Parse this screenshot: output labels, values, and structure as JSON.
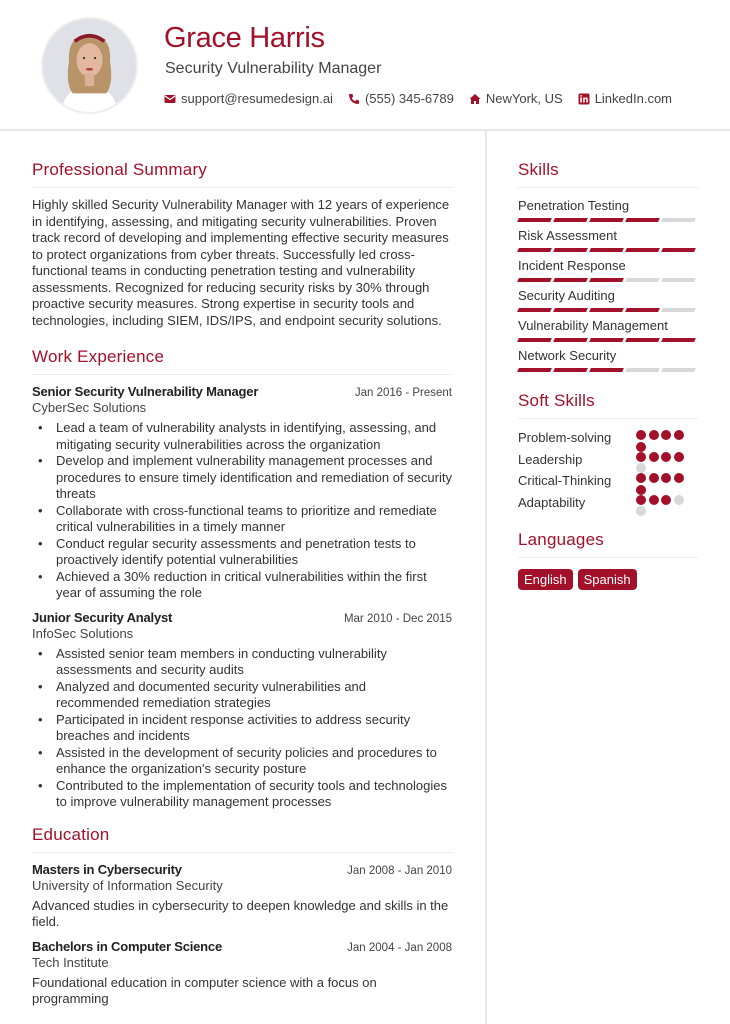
{
  "header": {
    "name": "Grace Harris",
    "title": "Security Vulnerability Manager",
    "contacts": [
      {
        "icon": "envelope-icon",
        "text": "support@resumedesign.ai"
      },
      {
        "icon": "phone-icon",
        "text": "(555) 345-6789"
      },
      {
        "icon": "home-icon",
        "text": "NewYork, US"
      },
      {
        "icon": "linkedin-icon",
        "text": "LinkedIn.com"
      }
    ]
  },
  "colors": {
    "accent": "#a31029",
    "inactive": "#d8d8d8"
  },
  "summary": {
    "title": "Professional Summary",
    "text": "Highly skilled Security Vulnerability Manager with 12 years of experience in identifying, assessing, and mitigating security vulnerabilities. Proven track record of developing and implementing effective security measures to protect organizations from cyber threats. Successfully led cross-functional teams in conducting penetration testing and vulnerability assessments. Recognized for reducing security risks by 30% through proactive security measures. Strong expertise in security tools and technologies, including SIEM, IDS/IPS, and endpoint security solutions."
  },
  "experience": {
    "title": "Work Experience",
    "jobs": [
      {
        "role": "Senior Security Vulnerability Manager",
        "dates": "Jan 2016 - Present",
        "company": "CyberSec Solutions",
        "bullets": [
          "Lead a team of vulnerability analysts in identifying, assessing, and mitigating security vulnerabilities across the organization",
          "Develop and implement vulnerability management processes and procedures to ensure timely identification and remediation of security threats",
          "Collaborate with cross-functional teams to prioritize and remediate critical vulnerabilities in a timely manner",
          "Conduct regular security assessments and penetration tests to proactively identify potential vulnerabilities",
          "Achieved a 30% reduction in critical vulnerabilities within the first year of assuming the role"
        ]
      },
      {
        "role": "Junior Security Analyst",
        "dates": "Mar 2010 - Dec 2015",
        "company": "InfoSec Solutions",
        "bullets": [
          "Assisted senior team members in conducting vulnerability assessments and security audits",
          "Analyzed and documented security vulnerabilities and recommended remediation strategies",
          "Participated in incident response activities to address security breaches and incidents",
          "Assisted in the development of security policies and procedures to enhance the organization's security posture",
          "Contributed to the implementation of security tools and technologies to improve vulnerability management processes"
        ]
      }
    ]
  },
  "education": {
    "title": "Education",
    "items": [
      {
        "degree": "Masters in Cybersecurity",
        "dates": "Jan 2008 - Jan 2010",
        "school": "University of Information Security",
        "description": "Advanced studies in cybersecurity to deepen knowledge and skills in the field."
      },
      {
        "degree": "Bachelors in Computer Science",
        "dates": "Jan 2004 - Jan 2008",
        "school": "Tech Institute",
        "description": "Foundational education in computer science with a focus on programming"
      }
    ]
  },
  "skills": {
    "title": "Skills",
    "max": 5,
    "items": [
      {
        "name": "Penetration Testing",
        "level": 4
      },
      {
        "name": "Risk Assessment",
        "level": 5
      },
      {
        "name": "Incident Response",
        "level": 3
      },
      {
        "name": "Security Auditing",
        "level": 4
      },
      {
        "name": "Vulnerability Management",
        "level": 5
      },
      {
        "name": "Network Security",
        "level": 3
      }
    ]
  },
  "soft_skills": {
    "title": "Soft Skills",
    "max": 5,
    "items": [
      {
        "name": "Problem-solving",
        "level": 5
      },
      {
        "name": "Leadership",
        "level": 4
      },
      {
        "name": "Critical-Thinking",
        "level": 5
      },
      {
        "name": "Adaptability",
        "level": 3
      }
    ]
  },
  "languages": {
    "title": "Languages",
    "items": [
      "English",
      "Spanish"
    ]
  }
}
